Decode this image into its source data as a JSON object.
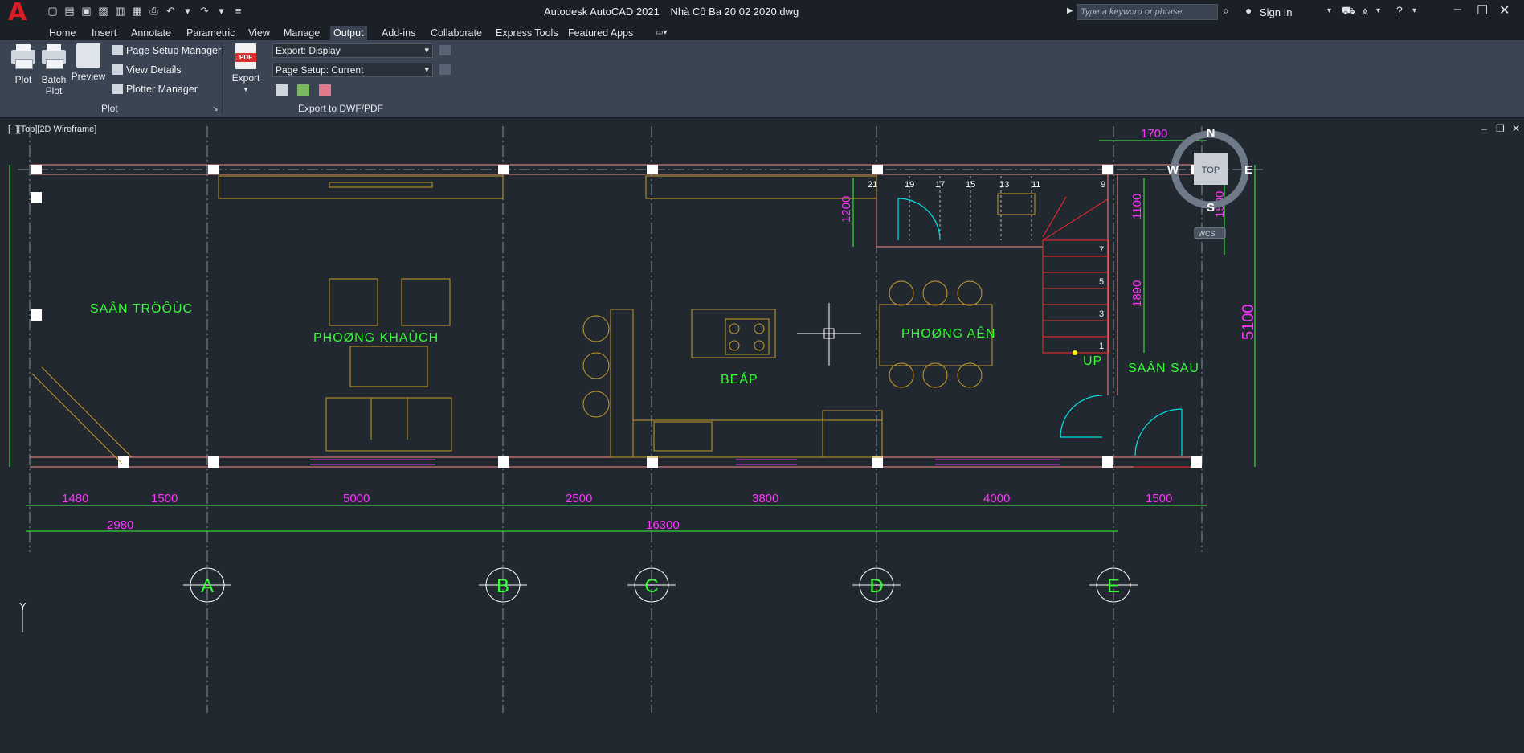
{
  "app": {
    "name": "Autodesk AutoCAD 2021",
    "file": "Nhà Cô Ba 20 02 2020.dwg"
  },
  "search": {
    "placeholder": "Type a keyword or phrase"
  },
  "user": {
    "signin": "Sign In"
  },
  "tabs": [
    "Home",
    "Insert",
    "Annotate",
    "Parametric",
    "View",
    "Manage",
    "Output",
    "Add-ins",
    "Collaborate",
    "Express Tools",
    "Featured Apps"
  ],
  "ribbon": {
    "plot": {
      "plot": "Plot",
      "batch": "Batch",
      "batch2": "Plot",
      "preview": "Preview",
      "page_setup": "Page Setup Manager",
      "view_details": "View Details",
      "plotter": "Plotter Manager",
      "panel": "Plot"
    },
    "export": {
      "button": "Export",
      "export_sel": "Export: Display",
      "page_setup_sel": "Page Setup: Current",
      "panel": "Export to DWF/PDF"
    }
  },
  "viewport": {
    "label": "[−][Top][2D Wireframe]"
  },
  "viewcube": {
    "n": "N",
    "s": "S",
    "e": "E",
    "w": "W",
    "top": "TOP",
    "wcs": "WCS"
  },
  "drawing": {
    "rooms": [
      "SAÂN TRÖÔÙC",
      "PHOØNG KHAÙCH",
      "BEÁP",
      "PHOØNG AÊN",
      "SAÂN SAU"
    ],
    "stair_numbers": [
      "21",
      "19",
      "17",
      "15",
      "13",
      "11",
      "9",
      "7",
      "5",
      "3",
      "1"
    ],
    "up_label": "UP",
    "dims_bottom_row1": [
      "1480",
      "1500",
      "5000",
      "2500",
      "3800",
      "4000",
      "1500"
    ],
    "dims_bottom_row2": [
      "2980",
      "16300"
    ],
    "dims_right": [
      "1700",
      "1100",
      "1890",
      "1500",
      "5100",
      "1200"
    ],
    "grid_axes": [
      "A",
      "B",
      "C",
      "D",
      "E"
    ]
  },
  "ucs": {
    "y": "Y"
  },
  "colors": {
    "accent": "#d81e24",
    "dim": "#ff33ff",
    "green": "#33ff33",
    "wall": "#ff7f7f",
    "furniture": "#c89d2a",
    "cyan": "#00e5e5"
  }
}
